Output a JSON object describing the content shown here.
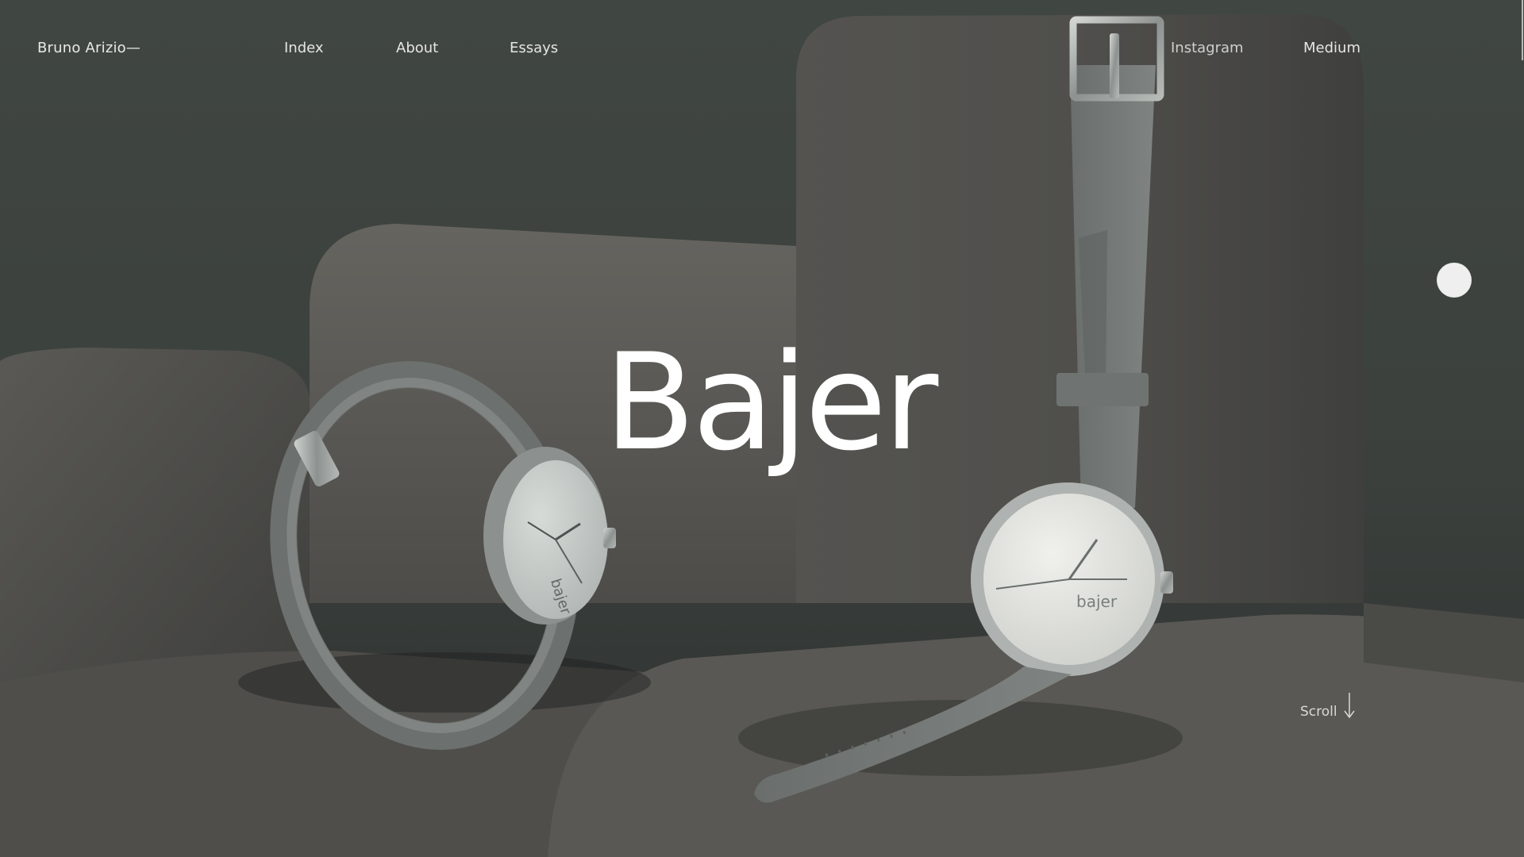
{
  "brand": {
    "name": "Bruno Arizio—"
  },
  "nav": {
    "index": "Index",
    "about": "About",
    "essays": "Essays",
    "instagram": "Instagram",
    "medium": "Medium"
  },
  "hero": {
    "title": "Bajer"
  },
  "controls": {
    "scroll_label": "Scroll",
    "dot_button_icon": "slide-indicator-icon",
    "scroll_icon": "arrow-down-icon"
  },
  "watches": {
    "left_dial_logo": "bajer",
    "right_dial_logo": "bajer"
  },
  "colors": {
    "background": "#3b403d",
    "velvet": "#5a5a57",
    "text": "#e6e6e2",
    "hero_text": "#ffffff",
    "watch_steel": "#9ea2a0",
    "watch_dial": "#c9ccca"
  }
}
